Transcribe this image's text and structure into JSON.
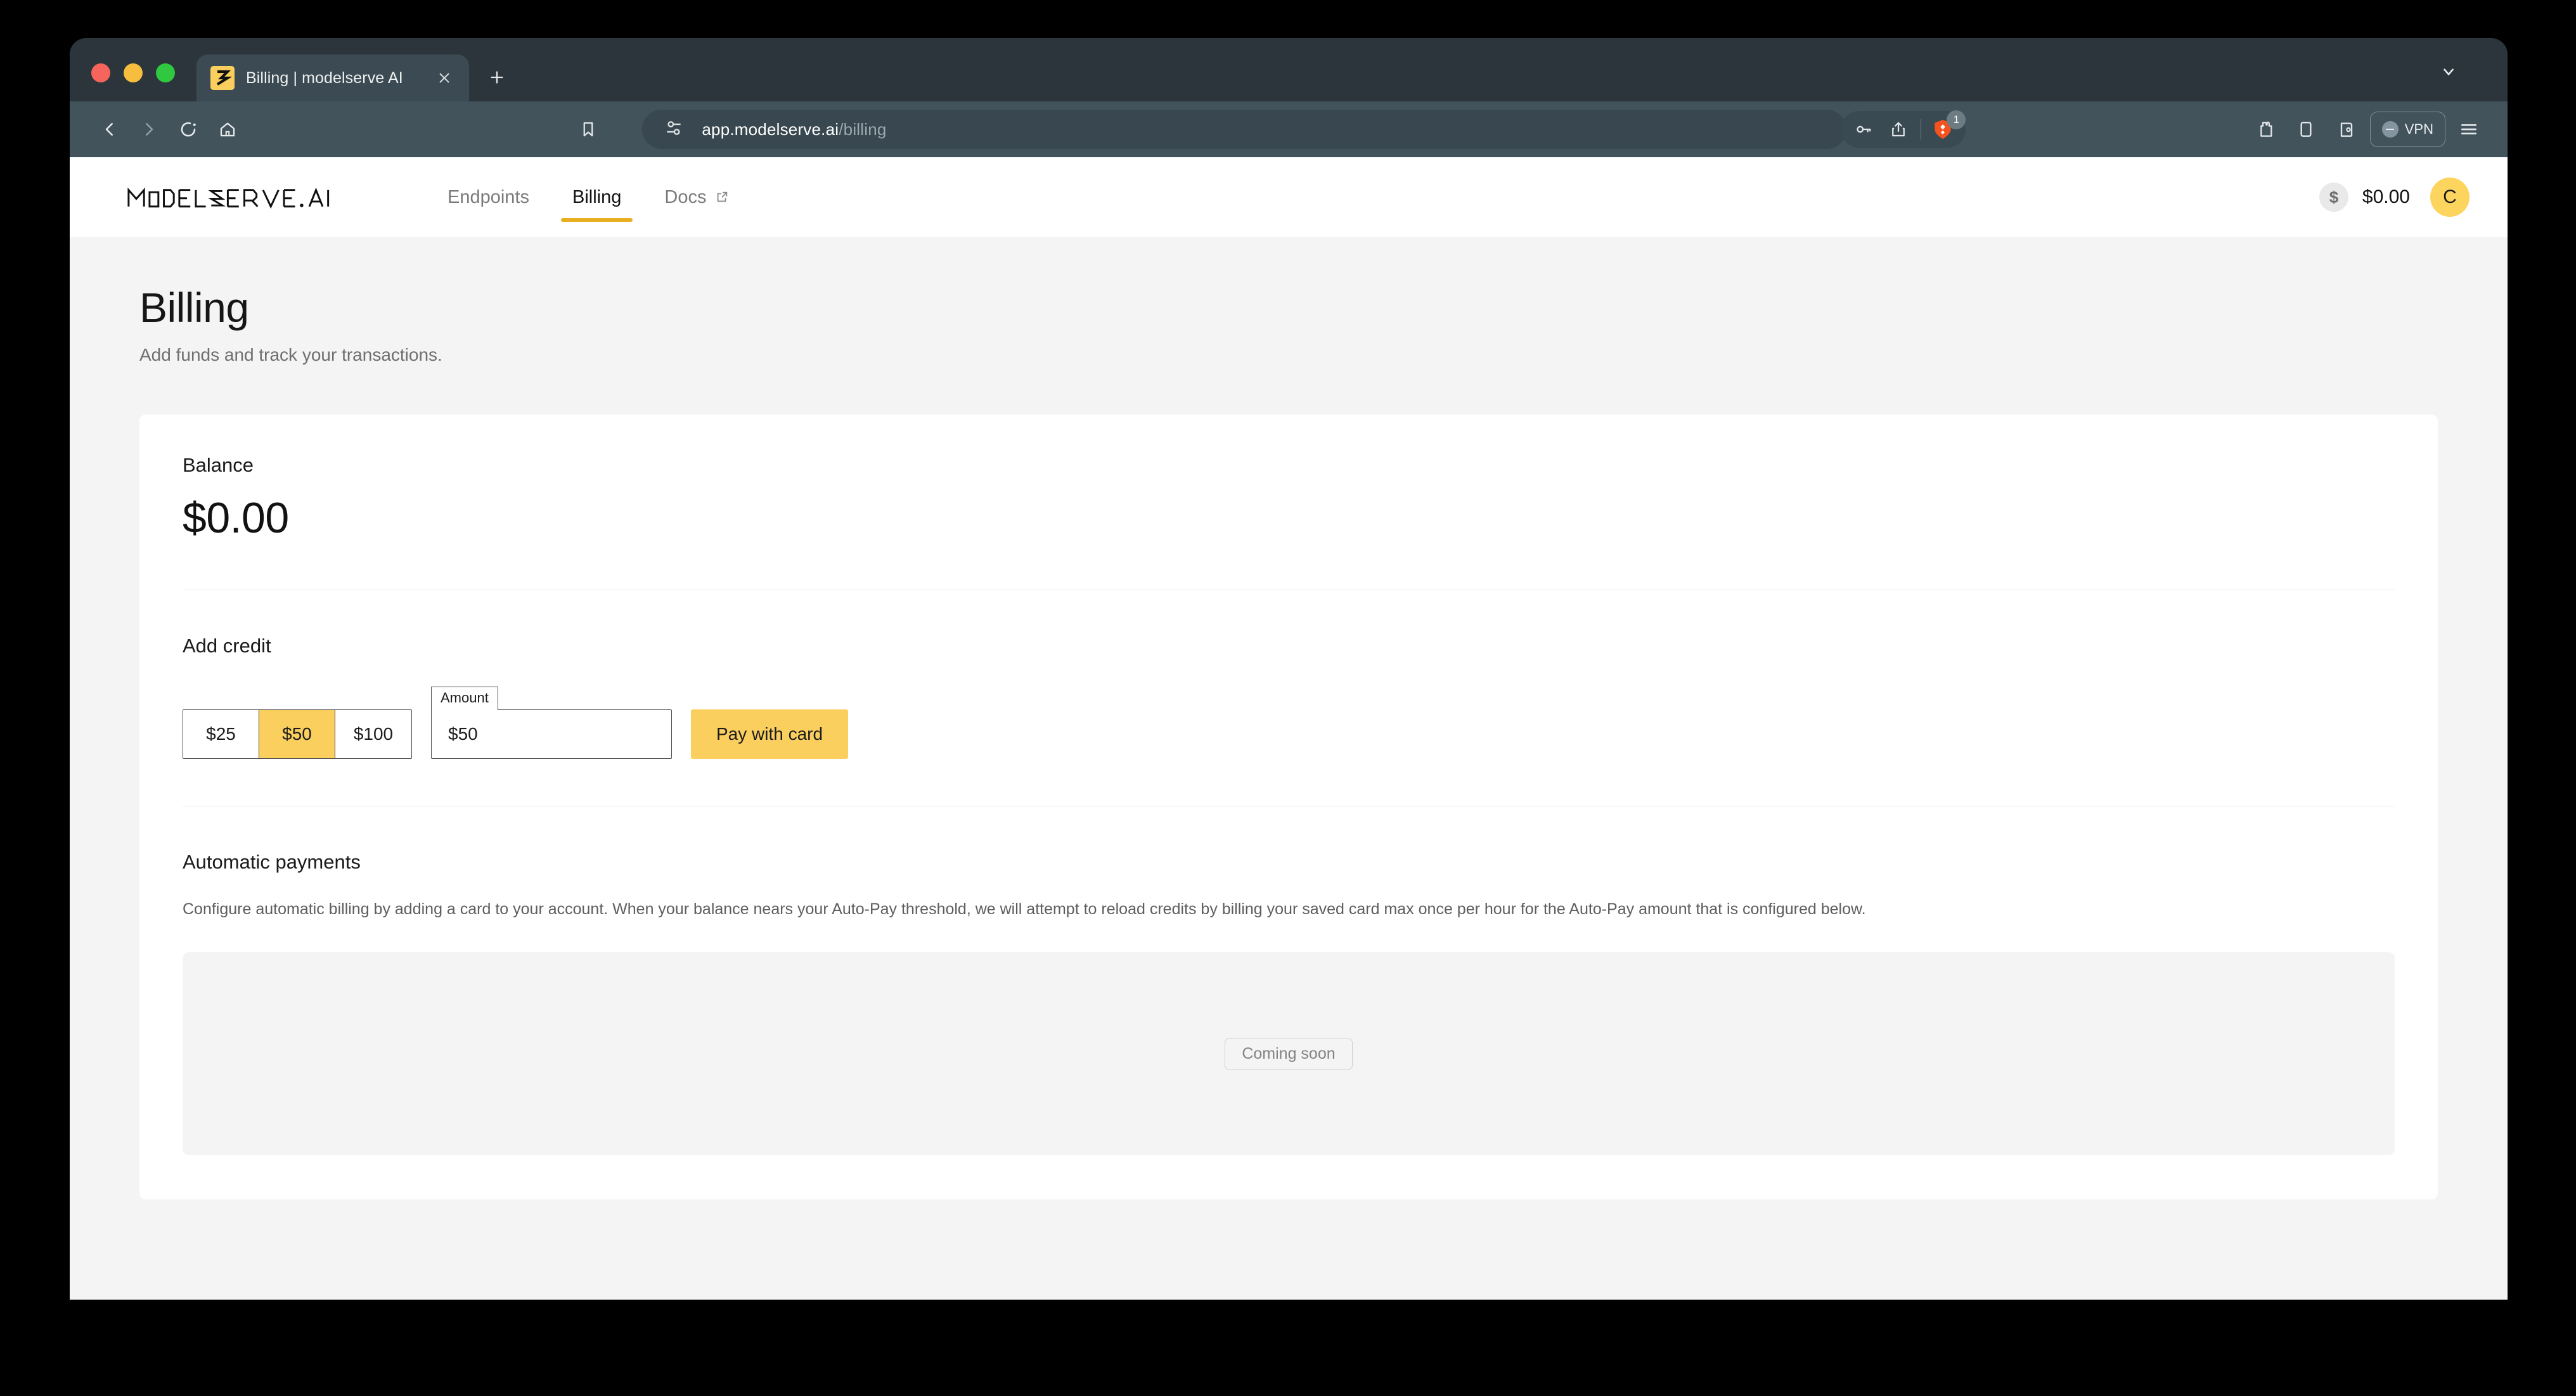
{
  "browser": {
    "tab": {
      "title": "Billing | modelserve AI",
      "favicon_icon": "modelserve-s-logo-icon",
      "close_icon": "close-icon"
    },
    "new_tab_icon": "plus-icon",
    "tab_list_icon": "chevron-down-icon",
    "nav": {
      "back_icon": "back-chevron-icon",
      "forward_icon": "forward-chevron-icon",
      "reload_icon": "reload-icon",
      "home_icon": "home-icon",
      "bookmark_icon": "bookmark-icon"
    },
    "url": {
      "origin": "app.modelserve.ai",
      "path": "/billing",
      "permission_icon": "site-settings-icon"
    },
    "url_actions": {
      "password_icon": "key-icon",
      "share_icon": "share-icon",
      "shields_icon": "brave-shields-icon",
      "shields_badge": "1"
    },
    "toolbar_right": {
      "extensions_icon": "extensions-icon",
      "sidebar_icon": "sidebar-icon",
      "wallet_icon": "wallet-icon",
      "vpn_label": "VPN",
      "vpn_icon": "vpn-toggle-icon",
      "menu_icon": "hamburger-menu-icon"
    }
  },
  "app": {
    "logo_text": "MODELSERVE.AI",
    "nav_items": [
      {
        "label": "Endpoints",
        "active": false,
        "external": false
      },
      {
        "label": "Billing",
        "active": true,
        "external": false
      },
      {
        "label": "Docs",
        "active": false,
        "external": true
      }
    ],
    "external_icon": "external-link-icon",
    "header_balance": {
      "icon": "dollar-sign-icon",
      "amount": "$0.00"
    },
    "avatar_initial": "C"
  },
  "page": {
    "title": "Billing",
    "subtitle": "Add funds and track your transactions."
  },
  "balance": {
    "label": "Balance",
    "value": "$0.00"
  },
  "add_credit": {
    "label": "Add credit",
    "presets": [
      {
        "label": "$25",
        "selected": false
      },
      {
        "label": "$50",
        "selected": true
      },
      {
        "label": "$100",
        "selected": false
      }
    ],
    "amount_label": "Amount",
    "amount_value": "$50",
    "amount_placeholder": "$50",
    "pay_button": "Pay with card"
  },
  "automatic_payments": {
    "label": "Automatic payments",
    "description": "Configure automatic billing by adding a card to your account. When your balance nears your Auto-Pay threshold, we will attempt to reload credits by billing your saved card max once per hour for the Auto-Pay amount that is configured below.",
    "coming_soon": "Coming soon"
  },
  "colors": {
    "accent_yellow": "#FBCF5E",
    "active_underline": "#E8AF21",
    "page_bg": "#F4F4F4",
    "browser_chrome": "#2B353B",
    "toolbar_bg": "#42535C"
  }
}
